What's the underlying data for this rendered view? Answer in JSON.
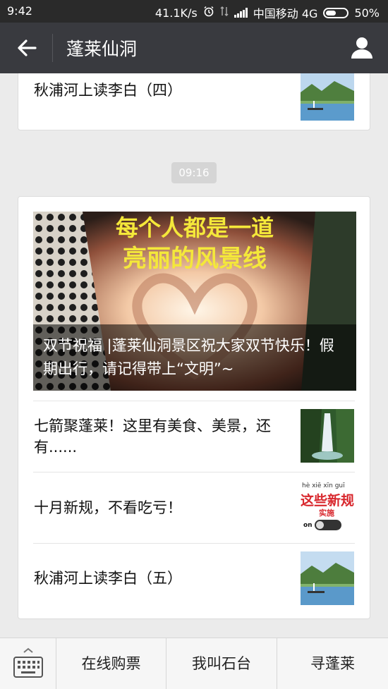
{
  "status_bar": {
    "time": "9:42",
    "speed": "41.1K/s",
    "carrier": "中国移动 4G",
    "battery": "50%",
    "battery_level": 0.5
  },
  "app_bar": {
    "back_icon": "arrow-left-icon",
    "title": "蓬莱仙洞",
    "profile_icon": "user-icon"
  },
  "top_card": {
    "item_title": "秋浦河上读李白（四）",
    "thumb_icon": "river-landscape-thumbnail"
  },
  "timestamp": "09:16",
  "feed_card": {
    "hero": {
      "image_text_line1": "每个人都是一道",
      "image_text_line2": "亮丽的风景线",
      "caption": "双节祝福 |蓬莱仙洞景区祝大家双节快乐！假期出行，请记得带上“文明”~"
    },
    "items": [
      {
        "title": "七箭聚蓬莱！这里有美食、美景，还有......",
        "thumb_icon": "waterfall-thumbnail"
      },
      {
        "title": "十月新规，不看吃亏！",
        "thumb_icon": "new-rules-thumbnail",
        "thumb_pinyin": "hè  xiē  xīn  guī",
        "thumb_big": "这些新规",
        "thumb_small": "实施",
        "thumb_toggle": "on"
      },
      {
        "title": "秋浦河上读李白（五）",
        "thumb_icon": "river-landscape-thumbnail"
      }
    ]
  },
  "bottom_bar": {
    "keyboard_icon": "keyboard-icon",
    "menus": [
      "在线购票",
      "我叫石台",
      "寻蓬莱"
    ]
  },
  "colors": {
    "status_bar_bg": "#2a2a2a",
    "app_bar_bg": "#393a3f",
    "page_bg": "#ebebeb"
  }
}
